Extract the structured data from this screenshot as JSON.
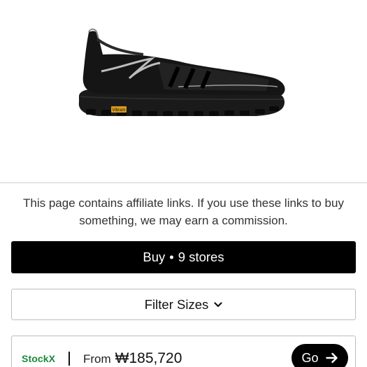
{
  "product": {
    "image_alt_icon": "running-shoe-image",
    "sole_brand_text": "Vibram"
  },
  "disclaimer": {
    "text": "This page contains affiliate links. If you use these links to buy something, we may earn a commission."
  },
  "buy": {
    "label": "Buy",
    "separator": "•",
    "stores": "9 stores"
  },
  "filter": {
    "label": "Filter Sizes",
    "icon": "chevron-down-icon"
  },
  "store_offer": {
    "store_name": "StockX",
    "store_color": "#1b8a3a",
    "separator": "|",
    "price_prefix": "From",
    "price": "₩185,720",
    "go_label": "Go",
    "go_icon": "arrow-right-icon"
  },
  "colors": {
    "primary_button": "#000000",
    "border": "#bdbdbd",
    "divider": "#cfcfcf"
  }
}
